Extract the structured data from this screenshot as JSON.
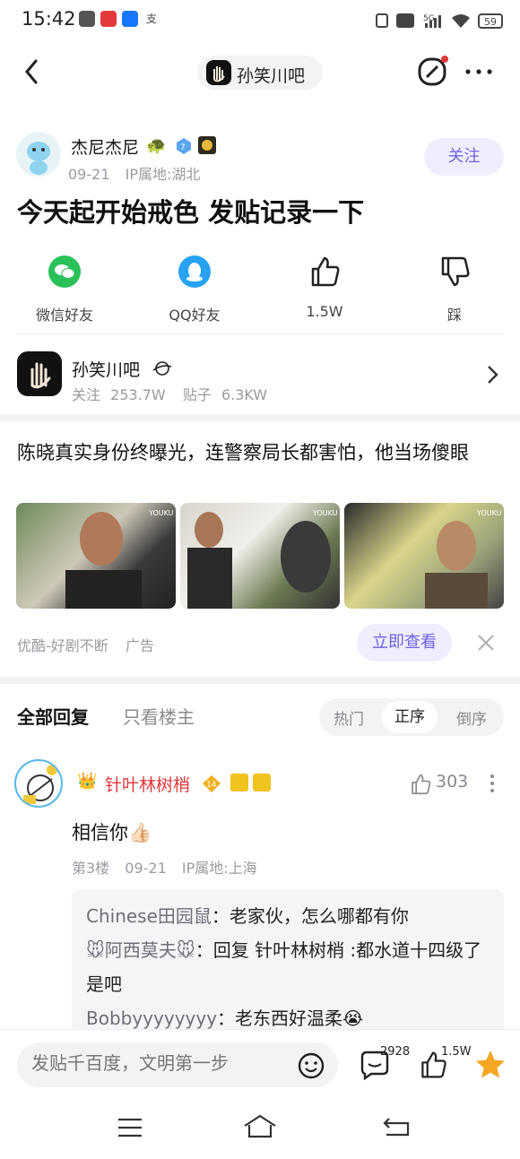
{
  "status_bar": {
    "time": "15:42",
    "battery": "59",
    "signal": "5G"
  },
  "header": {
    "forum_name": "孙笑川吧"
  },
  "post": {
    "author": "杰尼杰尼",
    "level": "7",
    "date": "09-21",
    "ip": "IP属地:湖北",
    "follow_label": "关注",
    "title": "今天起开始戒色  发贴记录一下"
  },
  "share": {
    "wechat": "微信好友",
    "qq": "QQ好友",
    "likes": "1.5W",
    "dislike": "踩"
  },
  "forum": {
    "name": "孙笑川吧",
    "follow_text": "关注",
    "follow_count": "253.7W",
    "posts_text": "贴子",
    "posts_count": "6.3KW"
  },
  "ad": {
    "title": "陈晓真实身份终曝光，连警察局长都害怕，他当场傻眼",
    "source": "优酷-好剧不断",
    "ad_label": "广告",
    "cta": "立即查看",
    "watermark": "YOUKU"
  },
  "replies_header": {
    "all": "全部回复",
    "op_only": "只看楼主",
    "sort": [
      "热门",
      "正序",
      "倒序"
    ],
    "sort_selected": "正序"
  },
  "reply": {
    "author": "针叶林树梢",
    "level": "14",
    "likes": "303",
    "text": "相信你👍🏻",
    "floor": "第3楼",
    "date": "09-21",
    "ip": "IP属地:上海",
    "subs": [
      {
        "name": "Chinese田园鼠",
        "text": "：老家伙，怎么哪都有你"
      },
      {
        "name": "🐭阿西莫夫🐭",
        "text": "：回复 针叶林树梢 :都水道十四级了是吧"
      },
      {
        "name": "Bobbyyyyyyyy",
        "text": "：老东西好温柔😭"
      }
    ]
  },
  "bottom_bar": {
    "placeholder": "发贴千百度，文明第一步",
    "comments": "2928",
    "likes": "1.5W"
  },
  "colors": {
    "accent": "#6f62e3",
    "red_name": "#e2383a",
    "wechat": "#2bc15a",
    "qq": "#28a3f3",
    "star": "#f5a623"
  }
}
